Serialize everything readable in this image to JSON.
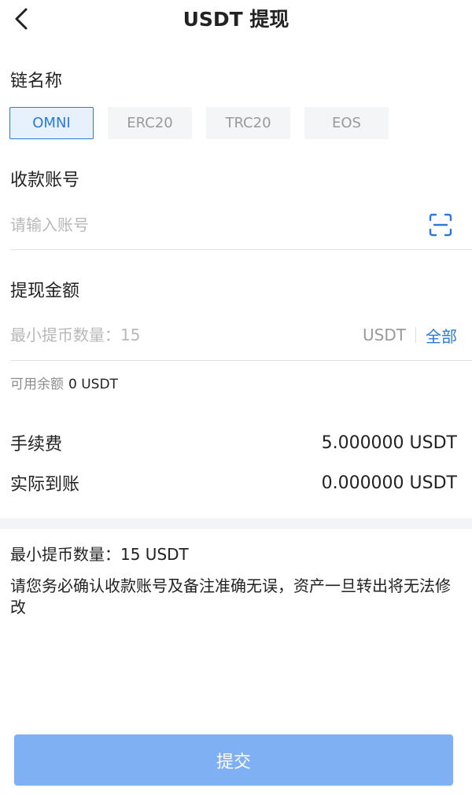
{
  "header": {
    "title": "USDT 提现",
    "back_icon": "chevron-left-icon"
  },
  "chain": {
    "label": "链名称",
    "options": [
      "OMNI",
      "ERC20",
      "TRC20",
      "EOS"
    ],
    "selected": "OMNI"
  },
  "account": {
    "label": "收款账号",
    "placeholder": "请输入账号",
    "value": "",
    "scan_icon": "scan-icon"
  },
  "amount": {
    "label": "提现金额",
    "placeholder": "最小提币数量：15",
    "value": "",
    "unit": "USDT",
    "all_label": "全部",
    "available_label": "可用余额",
    "available_value": "0 USDT"
  },
  "fee": {
    "label": "手续费",
    "value": "5.000000 USDT"
  },
  "received": {
    "label": "实际到账",
    "value": "0.000000 USDT"
  },
  "notice": {
    "min_text": "最小提币数量：15 USDT",
    "warning_text": "请您务必确认收款账号及备注准确无误，资产一旦转出将无法修改"
  },
  "submit": {
    "label": "提交"
  },
  "colors": {
    "accent": "#2d7ad6",
    "submit_bg": "#7fb0f3",
    "muted": "#9a9a9a"
  }
}
